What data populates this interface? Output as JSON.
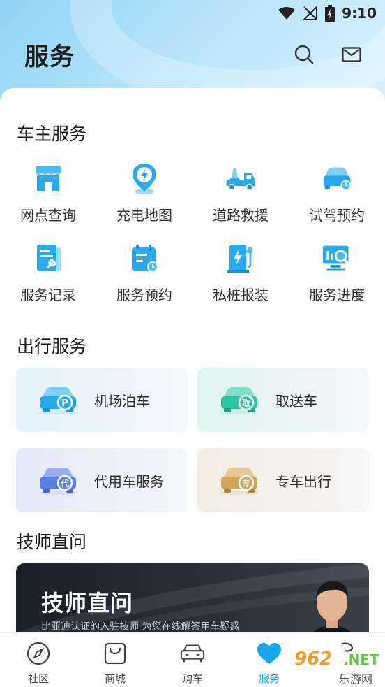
{
  "status_bar": {
    "time": "9:10"
  },
  "header": {
    "title": "服务"
  },
  "owner_services": {
    "title": "车主服务",
    "items": [
      {
        "label": "网点查询",
        "icon": "store-icon"
      },
      {
        "label": "充电地图",
        "icon": "charging-pin-icon"
      },
      {
        "label": "道路救援",
        "icon": "tow-truck-icon"
      },
      {
        "label": "试驾预约",
        "icon": "car-clock-icon"
      },
      {
        "label": "服务记录",
        "icon": "wrench-document-icon"
      },
      {
        "label": "服务预约",
        "icon": "calendar-clock-icon"
      },
      {
        "label": "私桩报装",
        "icon": "charger-pile-icon"
      },
      {
        "label": "服务进度",
        "icon": "monitor-search-icon"
      }
    ]
  },
  "travel_services": {
    "title": "出行服务",
    "items": [
      {
        "label": "机场泊车",
        "badge": "P",
        "icon": "car-parking-icon"
      },
      {
        "label": "取送车",
        "badge": "取",
        "icon": "car-pickup-icon"
      },
      {
        "label": "代用车服务",
        "badge": "代",
        "icon": "car-substitute-icon"
      },
      {
        "label": "专车出行",
        "badge": "专",
        "icon": "car-private-icon"
      }
    ]
  },
  "technician": {
    "title": "技师直问",
    "banner_title": "技师直问",
    "banner_subtitle": "比亚迪认证的入驻技师  为您在线解答用车疑惑"
  },
  "tabbar": {
    "items": [
      {
        "label": "社区",
        "icon": "compass-icon"
      },
      {
        "label": "商城",
        "icon": "shopping-bag-icon"
      },
      {
        "label": "购车",
        "icon": "car-icon"
      },
      {
        "label": "服务",
        "icon": "heart-icon",
        "active": true
      },
      {
        "label": "",
        "icon": "profile-icon"
      }
    ]
  },
  "watermark": {
    "num": "962",
    "net": ".NET",
    "cn": "乐游网"
  },
  "colors": {
    "accent": "#1aa6ea",
    "icon_blue": "#29a9ef",
    "title_dark": "#1e1e1e"
  }
}
